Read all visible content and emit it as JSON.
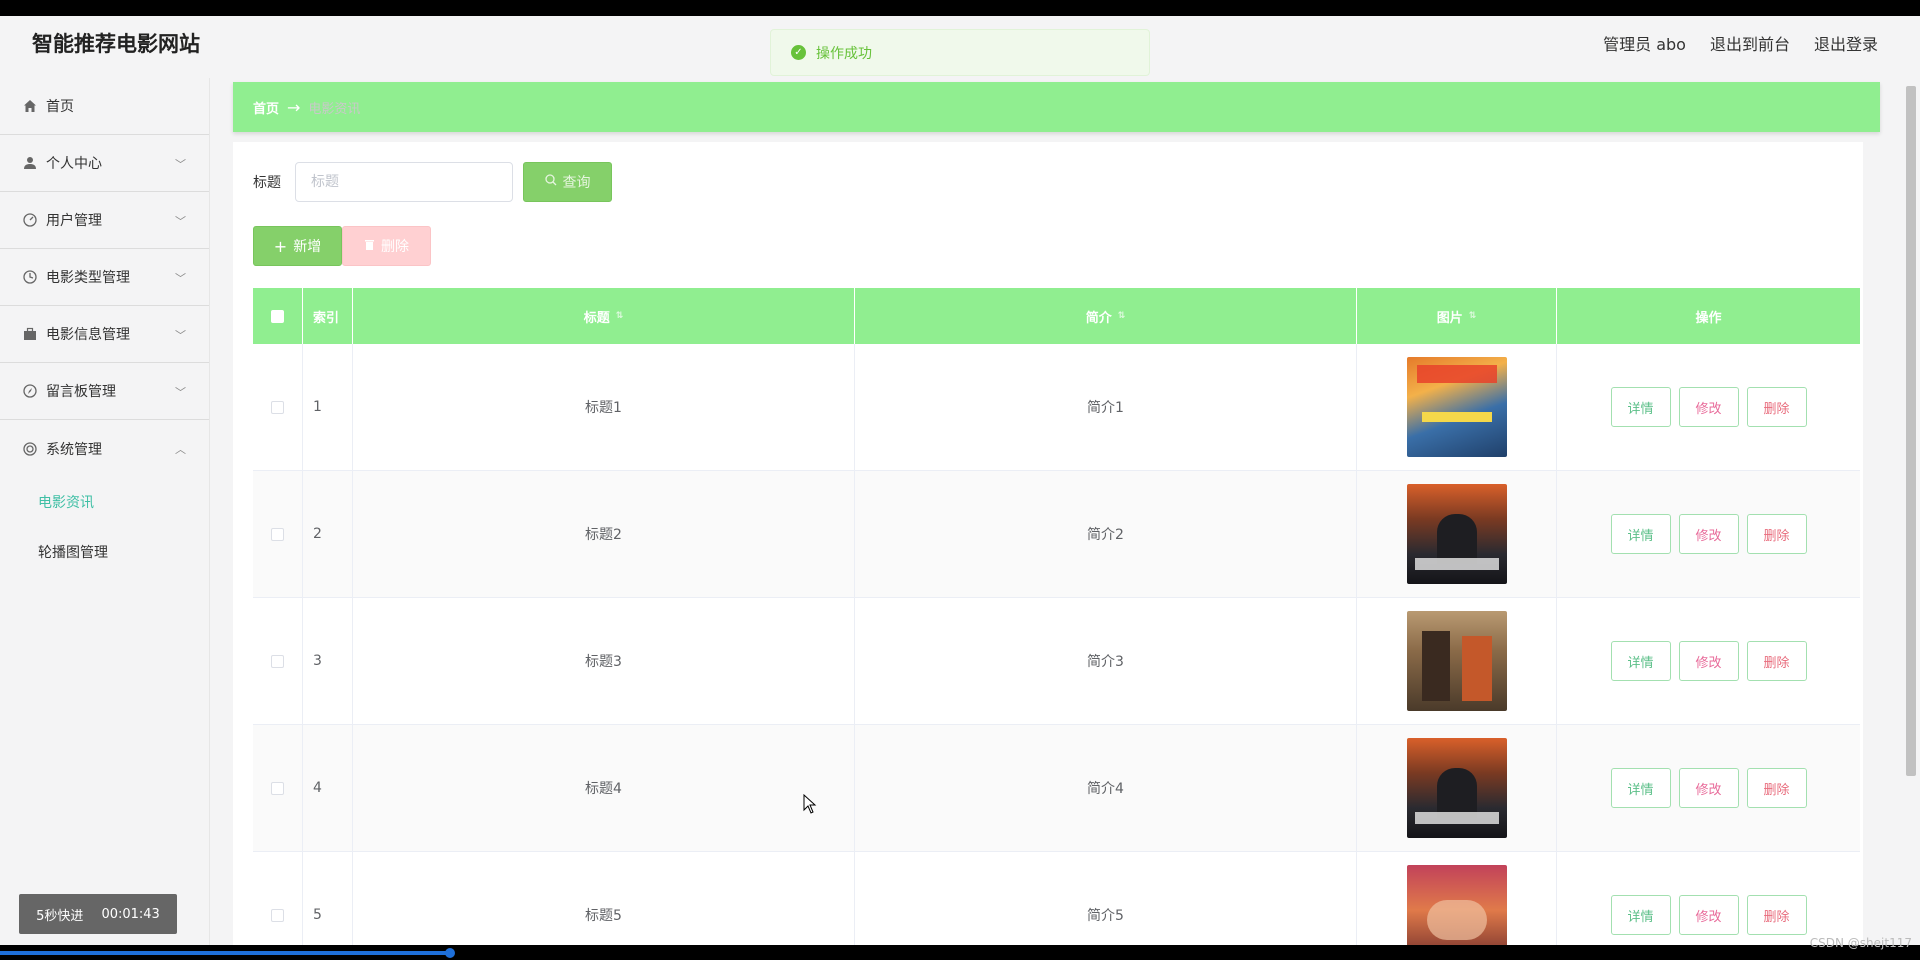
{
  "header": {
    "logo": "智能推荐电影网站",
    "links": [
      "管理员 abo",
      "退出到前台",
      "退出登录"
    ]
  },
  "toast": {
    "text": "操作成功"
  },
  "sidebar": {
    "items": [
      {
        "label": "首页",
        "icon": "home-icon",
        "chevron": false
      },
      {
        "label": "个人中心",
        "icon": "user-icon",
        "chevron": "down"
      },
      {
        "label": "用户管理",
        "icon": "gauge-icon",
        "chevron": "down"
      },
      {
        "label": "电影类型管理",
        "icon": "clock-icon",
        "chevron": "down"
      },
      {
        "label": "电影信息管理",
        "icon": "briefcase-icon",
        "chevron": "down"
      },
      {
        "label": "留言板管理",
        "icon": "compass-icon",
        "chevron": "down"
      },
      {
        "label": "系统管理",
        "icon": "settings-icon",
        "chevron": "up"
      }
    ],
    "subitems": [
      {
        "label": "电影资讯",
        "active": true
      },
      {
        "label": "轮播图管理",
        "active": false
      }
    ]
  },
  "breadcrumb": {
    "home": "首页",
    "current": "电影资讯"
  },
  "search": {
    "label": "标题",
    "placeholder": "标题",
    "button": "查询"
  },
  "actions": {
    "add": "新增",
    "delete": "删除"
  },
  "table": {
    "headers": {
      "index": "索引",
      "title": "标题",
      "intro": "简介",
      "image": "图片",
      "ops": "操作"
    },
    "rows": [
      {
        "index": "1",
        "title": "标题1",
        "intro": "简介1"
      },
      {
        "index": "2",
        "title": "标题2",
        "intro": "简介2"
      },
      {
        "index": "3",
        "title": "标题3",
        "intro": "简介3"
      },
      {
        "index": "4",
        "title": "标题4",
        "intro": "简介4"
      },
      {
        "index": "5",
        "title": "标题5",
        "intro": "简介5"
      }
    ],
    "ops": {
      "detail": "详情",
      "edit": "修改",
      "delete": "删除"
    }
  },
  "video": {
    "skip": "5秒快进",
    "time": "00:01:43"
  },
  "watermark": "CSDN @shejt117",
  "colors": {
    "accent": "#90ee90",
    "button": "#85d06a",
    "active_menu": "#3fbfa5"
  }
}
